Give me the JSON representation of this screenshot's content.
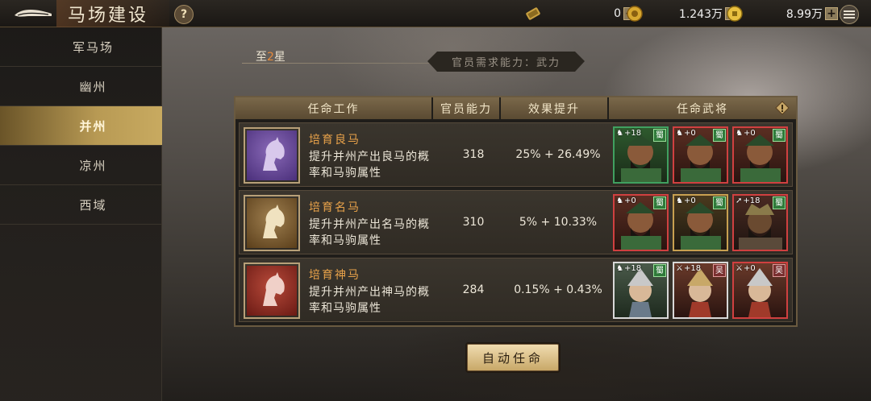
{
  "header": {
    "title": "马场建设",
    "help_label": "?"
  },
  "resources": [
    {
      "icon": "scroll-icon",
      "value": "0"
    },
    {
      "icon": "copper-coin-icon",
      "value": "1.243万"
    },
    {
      "icon": "gold-coin-icon",
      "value": "8.99万"
    }
  ],
  "sidebar": {
    "items": [
      {
        "label": "军马场",
        "active": false
      },
      {
        "label": "幽州",
        "active": false
      },
      {
        "label": "并州",
        "active": true
      },
      {
        "label": "凉州",
        "active": false
      },
      {
        "label": "西域",
        "active": false
      }
    ]
  },
  "star": {
    "prefix": "至",
    "num": "2",
    "suffix": "星"
  },
  "requirement": "官员需求能力：武力",
  "table": {
    "headers": [
      "任命工作",
      "官员能力",
      "效果提升",
      "任命武将"
    ],
    "rows": [
      {
        "title": "培育良马",
        "desc": "提升并州产出良马的概率和马驹属性",
        "ability": "318",
        "effect": "25% + 26.49%",
        "horse_color": "purple",
        "generals": [
          {
            "level": "+18",
            "faction": "蜀",
            "frame": "green"
          },
          {
            "level": "+0",
            "faction": "蜀",
            "frame": "red"
          },
          {
            "level": "+0",
            "faction": "蜀",
            "frame": "red"
          }
        ]
      },
      {
        "title": "培育名马",
        "desc": "提升并州产出名马的概率和马驹属性",
        "ability": "310",
        "effect": "5% + 10.33%",
        "horse_color": "gold",
        "generals": [
          {
            "level": "+0",
            "faction": "蜀",
            "frame": "red"
          },
          {
            "level": "+0",
            "faction": "蜀",
            "frame": "gold"
          },
          {
            "level": "+18",
            "faction": "蜀",
            "frame": "red"
          }
        ]
      },
      {
        "title": "培育神马",
        "desc": "提升并州产出神马的概率和马驹属性",
        "ability": "284",
        "effect": "0.15% + 0.43%",
        "horse_color": "red",
        "generals": [
          {
            "level": "+18",
            "faction": "蜀",
            "frame": "white"
          },
          {
            "level": "+18",
            "faction": "吴",
            "frame": "white"
          },
          {
            "level": "+0",
            "faction": "吴",
            "frame": "red"
          }
        ]
      }
    ]
  },
  "auto_button": "自动任命"
}
